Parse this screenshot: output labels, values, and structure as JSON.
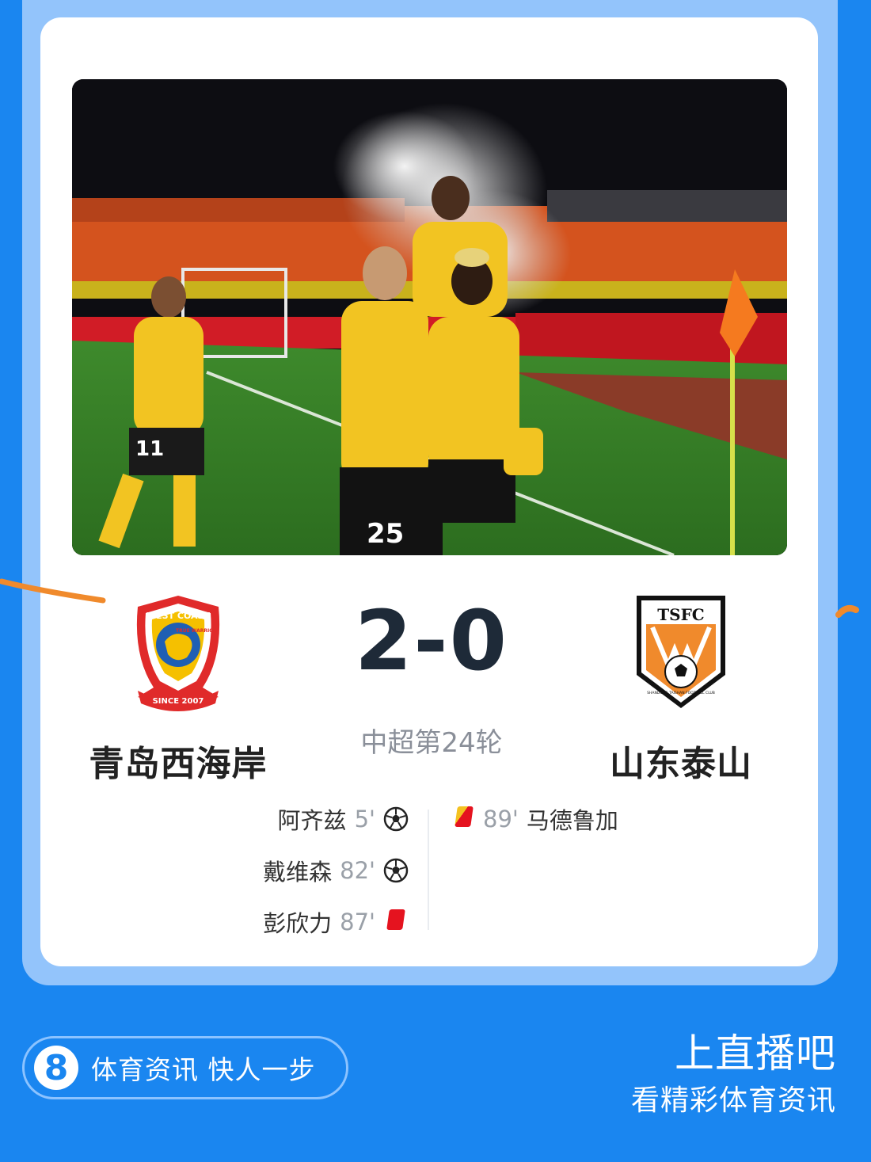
{
  "match": {
    "home_team": "青岛西海岸",
    "away_team": "山东泰山",
    "score": "2-0",
    "round": "中超第24轮"
  },
  "home_crest": {
    "top_text": "WEST COAST",
    "middle_text": "TRUE WARRIOR",
    "bottom_text": "SINCE 2007"
  },
  "away_crest": {
    "top_text": "TSFC",
    "ring_text": "SHANDONG TAISHAN FOOTBALL CLUB"
  },
  "home_events": [
    {
      "player": "阿齐兹",
      "minute": "5'",
      "type": "goal",
      "icon": "football-icon"
    },
    {
      "player": "戴维森",
      "minute": "82'",
      "type": "goal",
      "icon": "football-icon"
    },
    {
      "player": "彭欣力",
      "minute": "87'",
      "type": "red-card",
      "icon": "red-card-icon"
    }
  ],
  "away_events": [
    {
      "player": "马德鲁加",
      "minute": "89'",
      "type": "second-yellow",
      "icon": "second-yellow-card-icon"
    }
  ],
  "photo": {
    "jersey_numbers": [
      "11",
      "25"
    ]
  },
  "footer": {
    "badge": "8",
    "slogan": "体育资讯 快人一步",
    "brand_title": "上直播吧",
    "brand_subtitle": "看精彩体育资讯"
  },
  "colors": {
    "background": "#1a86f0",
    "frame": "#93c4fb",
    "score": "#1e2a38",
    "red_card": "#e5131f",
    "yellow_card": "#f4c220"
  }
}
